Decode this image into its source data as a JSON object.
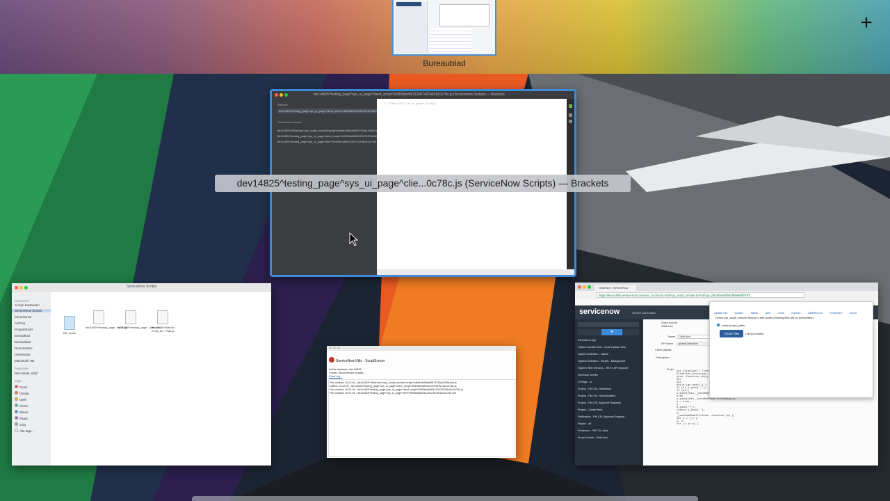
{
  "spaces": {
    "desktop_label": "Bureaublad",
    "add_label": "+"
  },
  "windows": {
    "brackets": {
      "title": "dev14825^testing_page^sys_ui_page^client_script^e59f3bbd4f9312007437bb1810c78c.js (ServiceNow Scripts) — Brackets",
      "tooltip": "dev14825^testing_page^sys_ui_page^clie...0c78c.js (ServiceNow Scripts) — Brackets",
      "working_files_label": "Werkset",
      "working_file": "dev14825^testing_page^sys_ui_page^client_script^e59f3bbd4f9312007437bb1810c78c.js",
      "folder_label": "ServiceNow Scripts",
      "files": [
        "dev14825^GlideJson^sys_script_include^script^a4fefbd4f58a806797f3a181f5b1a3",
        "dev14825^testing_page^sys_ui_page^client_script^e59f3bbd4f9312007437bb1810c",
        "dev14825^testing_page^sys_ui_page^html^e59f3bbd4f9312007437bb1810c78c"
      ],
      "code_line": "1   //This will be a great script"
    },
    "finder": {
      "title": "ServiceNow Scripts",
      "sections": {
        "favorites": "Favorieten",
        "devices": "Apparaten",
        "tags": "Tags"
      },
      "favorites": [
        "Al mijn bestanden",
        "ServiceNow Scripts",
        "iCloud Drive",
        "AirDrop",
        "Programma's",
        "arnoudkooi",
        "Bureaublad",
        "Documenten",
        "Downloads",
        "Macintosh HD"
      ],
      "devices": [
        "Niet-lokale schijf"
      ],
      "tags": [
        "Rood",
        "Oranje",
        "Geel",
        "Groen",
        "Blauw",
        "Paars",
        "Grijs",
        "Alle tags..."
      ],
      "tag_colors": [
        "#e74c3c",
        "#e67e22",
        "#f1c40f",
        "#2ecc71",
        "#3498db",
        "#9b59b6",
        "#95a5a6",
        "#ffffff"
      ],
      "files": [
        {
          "name": "ZIB_Auam",
          "kind": "folder"
        },
        {
          "name": "dev14825^testing_page...0c78c.js",
          "kind": "file"
        },
        {
          "name": "dev14825^testing_page...c78c.xml",
          "kind": "file"
        },
        {
          "name": "dev14825^GlideJso n^sys_sc...79a3.js",
          "kind": "file"
        }
      ]
    },
    "syncer": {
      "heading": "ServiceNow Utils - ScriptSyncer",
      "instance": "Active instance: dev14825",
      "folder": "Folder: /ServiceNow Scripts...",
      "clear": "Clear log...",
      "log": [
        "File created: 10:22:46 - dev14825^GlideJson^sys_script_include^script^a4fefbd4f58a806797f3a181f5b1a3.js",
        "Edited: 10:22:09 - dev14825^testing_page^sys_ui_page^client_script^e59f3bbd4f9312007437bb1810c78c.js",
        "File created: 10:21:25 - dev14825^testing_page^sys_ui_page^client_script^e59f3bbd4f9312007437bb1810c78c.js",
        "File created: 10:21:25 - dev14825^testing_page^sys_ui_page^html^e59f3bbd4f9312007437bb1810c78c.xml"
      ]
    },
    "servicenow": {
      "tab": "GlideJson | ServiceNow",
      "url": "https://dev14825.service-now.com/nav_to.do?uri=%2Fsys_script_include.do%3Fsys_id%3Da4fefbd4f58a806797f3",
      "bookmarks": [
        "Apps",
        "Dashboard",
        "Links",
        "YouTube",
        "IMF Personal",
        "WW"
      ],
      "brand": "servicenow",
      "subtitle": "Service Automation",
      "nav_items": [
        "Extension Logs",
        "System Update Sets - Local Update Sets",
        "System Definition - Tables",
        "System Definition - Scripts - Background",
        "System Web Services - REST API Explorer",
        "Schedule Entries",
        "UI Page - ui",
        "Project - PM CSL Definitions",
        "Project - PM CSL Rescenceitles",
        "Project - PM CSL Approval Requests",
        "Project - Create New",
        "Notification - PM CSL Approval Request ...",
        "Project - All",
        "Processor - PM CSL data",
        "Script Include - GlideJson"
      ],
      "form": {
        "breadcrumb": "Script Include",
        "breadcrumb_sub": "GlideJson",
        "name_label": "Name",
        "name_value": "GlideJson",
        "api_label": "API Name",
        "api_value": "global.GlideJson",
        "client_label": "Client callable",
        "desc_label": "Description",
        "script_label": "Script"
      },
      "popup": {
        "menu": [
          "Update Set",
          "Update",
          "Tables",
          "User",
          "Links",
          "Frames",
          "GlideRecord",
          "ScriptSync",
          "About"
        ],
        "message": "Select sys_script_include field(s) to edit locally (existing files will be overwritten):",
        "script_option": "script (script_plain)",
        "button": "Create Files",
        "created": "1 file(s) created"
      },
      "code": [
        "var GlideJson = Class.create();",
        "GlideJson.prototype = {",
        "    json: function (obj) {",
        "        var ",
        "        var ",
        "        while (gr.next()) {",
        "            if (o) o.push(',');",
        "            if (arr)",
        "                o.push(this._jsonOneRowSelectedFields(gr, arr));",
        "            else",
        "                o.push(this._jsonOneRowAllFields(gr));",
        "            o = true;",
        "        }",
        "        o.push(']');",
        "        return o.join('');",
        "    },",
        "    _jsonOneRowAllFields: function (o) {",
        "        var o = ['{'],",
        "            t, c;",
        "        for (i in o) {"
      ]
    }
  },
  "colors": {
    "accent": "#3d8bd8",
    "servicenow_header": "#303a46",
    "servicenow_button": "#2b5d9c"
  }
}
